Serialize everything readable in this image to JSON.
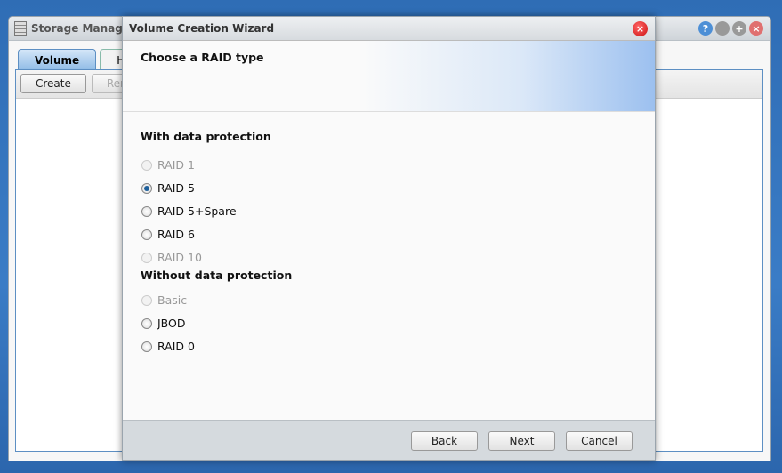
{
  "background_window": {
    "title": "Storage Manager",
    "tabs": [
      "Volume",
      "HDD Management"
    ],
    "toolbar": [
      "Create",
      "Remove"
    ]
  },
  "wizard": {
    "title": "Volume Creation Wizard",
    "heading": "Choose a RAID type",
    "sections": [
      {
        "label": "With data protection",
        "options": [
          {
            "label": "RAID 1",
            "disabled": true,
            "selected": false
          },
          {
            "label": "RAID 5",
            "disabled": false,
            "selected": true
          },
          {
            "label": "RAID 5+Spare",
            "disabled": false,
            "selected": false
          },
          {
            "label": "RAID 6",
            "disabled": false,
            "selected": false
          },
          {
            "label": "RAID 10",
            "disabled": true,
            "selected": false
          }
        ]
      },
      {
        "label": "Without data protection",
        "options": [
          {
            "label": "Basic",
            "disabled": true,
            "selected": false
          },
          {
            "label": "JBOD",
            "disabled": false,
            "selected": false
          },
          {
            "label": "RAID 0",
            "disabled": false,
            "selected": false
          }
        ]
      }
    ],
    "buttons": {
      "back": "Back",
      "next": "Next",
      "cancel": "Cancel"
    }
  }
}
